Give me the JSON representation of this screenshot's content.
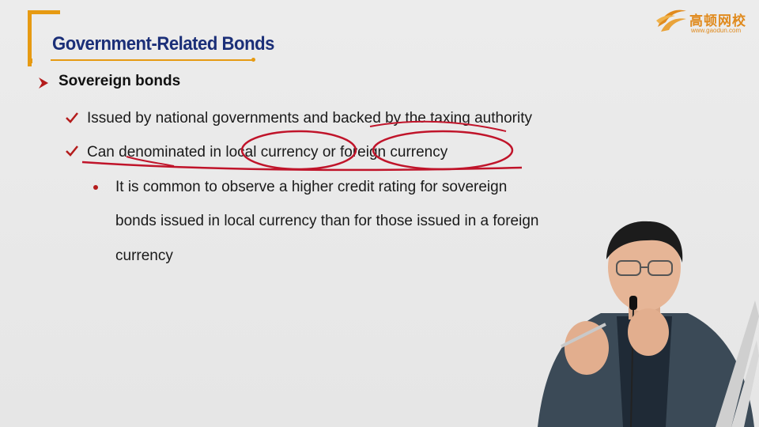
{
  "slide": {
    "title": "Government-Related Bonds",
    "logo": {
      "name": "高顿网校",
      "url": "www.gaodun.com"
    },
    "level1": "Sovereign bonds",
    "points": [
      "Issued by national governments and backed by the taxing authority",
      "Can denominated in local currency or foreign currency"
    ],
    "sub_point_lines": [
      "It is common to observe a higher credit rating for sovereign",
      "bonds issued in local currency than for those issued in a foreign",
      "currency"
    ]
  },
  "colors": {
    "title": "#1b2f78",
    "accent": "#e69a12",
    "check": "#b41c1c",
    "annotation": "#c0142a"
  },
  "icons": [
    "arrow-bullet-icon",
    "check-icon",
    "dot-bullet-icon",
    "gaodun-logo-icon"
  ]
}
